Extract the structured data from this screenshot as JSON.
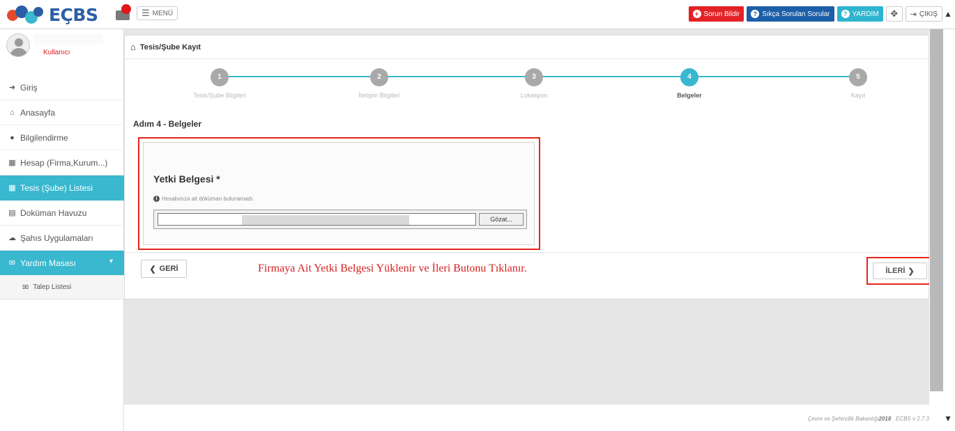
{
  "topbar": {
    "logo_text": "EÇBS",
    "menu_label": "MENÜ",
    "sorun_label": "Sorun Bildir",
    "faq_label": "Sıkça Sorulan Sorular",
    "help_label": "YARDIM",
    "exit_label": "ÇIKIŞ"
  },
  "user": {
    "name": "Kullanıcı"
  },
  "sidebar": {
    "items": [
      {
        "label": "Giriş",
        "icon": "sign-in-icon"
      },
      {
        "label": "Anasayfa",
        "icon": "home-icon"
      },
      {
        "label": "Bilgilendirme",
        "icon": "info-icon"
      },
      {
        "label": "Hesap (Firma,Kurum...)",
        "icon": "building-icon"
      },
      {
        "label": "Tesis (Şube) Listesi",
        "icon": "building-icon"
      },
      {
        "label": "Doküman Havuzu",
        "icon": "documents-icon"
      },
      {
        "label": "Şahıs Uygulamaları",
        "icon": "cloud-icon"
      },
      {
        "label": "Yardım Masası",
        "icon": "envelope-icon"
      }
    ],
    "sub_items": [
      {
        "label": "Talep Listesi",
        "icon": "envelope-icon"
      }
    ]
  },
  "page": {
    "breadcrumb": "Tesis/Şube Kayıt",
    "steps": [
      {
        "num": "1",
        "label": "Tesis/Şube Bilgileri"
      },
      {
        "num": "2",
        "label": "İletişim Bilgileri"
      },
      {
        "num": "3",
        "label": "Lokasyon"
      },
      {
        "num": "4",
        "label": "Belgeler"
      },
      {
        "num": "5",
        "label": "Kayıt"
      }
    ],
    "active_step": 4,
    "step_title": "Adım 4 - Belgeler",
    "doc_title": "Yetki Belgesi *",
    "doc_info": "Hesabınıza ait döküman bulunamadı.",
    "browse_label": "Gözat...",
    "back_label": "GERİ",
    "next_label": "İLERİ",
    "note": "Firmaya Ait Yetki Belgesi Yüklenir ve İleri Butonu Tıklanır."
  },
  "footer": {
    "org": "Çevre ve Şehircilik Bakanlığı",
    "year": "2018",
    "version": "ECBS v 2.7.3"
  },
  "colors": {
    "accent": "#39b8cf",
    "brand_blue": "#2b5fa5",
    "alert_red": "#e3241b"
  }
}
